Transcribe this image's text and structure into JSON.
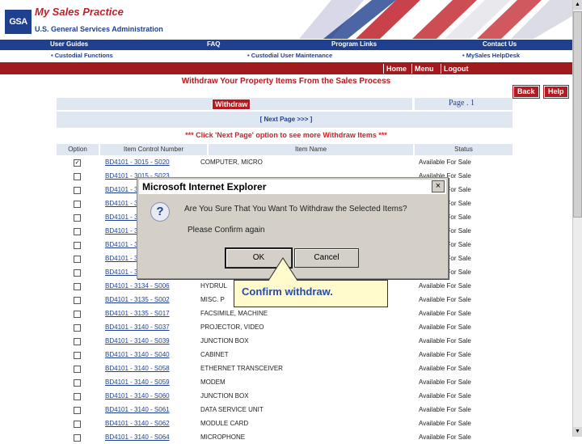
{
  "header": {
    "app_title": "My Sales Practice",
    "agency": "U.S. General Services Administration",
    "logo_text": "GSA"
  },
  "nav_top": [
    "User Guides",
    "FAQ",
    "Program Links",
    "Contact Us"
  ],
  "nav_sub": [
    "• Custodial Functions",
    "• Custodial User Maintenance",
    "• MySales HelpDesk"
  ],
  "nav_main": [
    "Home",
    "Menu",
    "Logout"
  ],
  "page_heading": "Withdraw Your Property Items From the Sales Process",
  "actions": {
    "back": "Back",
    "help": "Help",
    "withdraw": "Withdraw"
  },
  "page_label": "Page . 1",
  "next_page": "[ Next Page >>> ]",
  "notice": "*** Click 'Next Page' option to see more Withdraw Items ***",
  "table": {
    "columns": [
      "Option",
      "Item Control Number",
      "Item Name",
      "Status"
    ],
    "rows": [
      {
        "checked": true,
        "control": "BD4101 - 3015 - S020",
        "name": "COMPUTER, MICRO",
        "status": "Available For Sale"
      },
      {
        "checked": false,
        "control": "BD4101 - 3015 - S023",
        "name": "",
        "status": "Available For Sale"
      },
      {
        "checked": false,
        "control": "BD4101 - 3",
        "name": "",
        "status": "Available For Sale"
      },
      {
        "checked": false,
        "control": "BD4101 - 3",
        "name": "",
        "status": "Available For Sale"
      },
      {
        "checked": false,
        "control": "BD4101 - 3",
        "name": "",
        "status": "Available For Sale"
      },
      {
        "checked": false,
        "control": "BD4101 - 3",
        "name": "",
        "status": "Available For Sale"
      },
      {
        "checked": false,
        "control": "BD4101 - 3",
        "name": "",
        "status": "Available For Sale"
      },
      {
        "checked": false,
        "control": "BD4101 - 3",
        "name": "",
        "status": "Available For Sale"
      },
      {
        "checked": false,
        "control": "BD4101 - 3",
        "name": "",
        "status": "Available For Sale"
      },
      {
        "checked": false,
        "control": "BD4101 - 3134 - S006",
        "name": "HYDRUL",
        "status": "Available For Sale"
      },
      {
        "checked": false,
        "control": "BD4101 - 3135 - S002",
        "name": "MISC. P",
        "status": "Available For Sale"
      },
      {
        "checked": false,
        "control": "BD4101 - 3135 - S017",
        "name": "FACSIMILE, MACHINE",
        "status": "Available For Sale"
      },
      {
        "checked": false,
        "control": "BD4101 - 3140 - S037",
        "name": "PROJECTOR, VIDEO",
        "status": "Available For Sale"
      },
      {
        "checked": false,
        "control": "BD4101 - 3140 - S039",
        "name": "JUNCTION BOX",
        "status": "Available For Sale"
      },
      {
        "checked": false,
        "control": "BD4101 - 3140 - S040",
        "name": "CABINET",
        "status": "Available For Sale"
      },
      {
        "checked": false,
        "control": "BD4101 - 3140 - S058",
        "name": "ETHERNET TRANSCEIVER",
        "status": "Available For Sale"
      },
      {
        "checked": false,
        "control": "BD4101 - 3140 - S059",
        "name": "MODEM",
        "status": "Available For Sale"
      },
      {
        "checked": false,
        "control": "BD4101 - 3140 - S060",
        "name": "JUNCTION BOX",
        "status": "Available For Sale"
      },
      {
        "checked": false,
        "control": "BD4101 - 3140 - S061",
        "name": "DATA SERVICE UNIT",
        "status": "Available For Sale"
      },
      {
        "checked": false,
        "control": "BD4101 - 3140 - S062",
        "name": "MODULE CARD",
        "status": "Available For Sale"
      },
      {
        "checked": false,
        "control": "BD4101 - 3140 - S064",
        "name": "MICROPHONE",
        "status": "Available For Sale"
      }
    ]
  },
  "dialog": {
    "title": "Microsoft Internet Explorer",
    "message": "Are You Sure That You Want To Withdraw the Selected Items?",
    "sub": "Please Confirm again",
    "ok": "OK",
    "cancel": "Cancel",
    "close": "×"
  },
  "callout": "Confirm withdraw.",
  "colors": {
    "navy": "#1f3f8f",
    "red": "#b01c22",
    "light_blue": "#dfe7f3",
    "dialog_gray": "#d4d0c8",
    "callout_bg": "#fffbcc"
  }
}
